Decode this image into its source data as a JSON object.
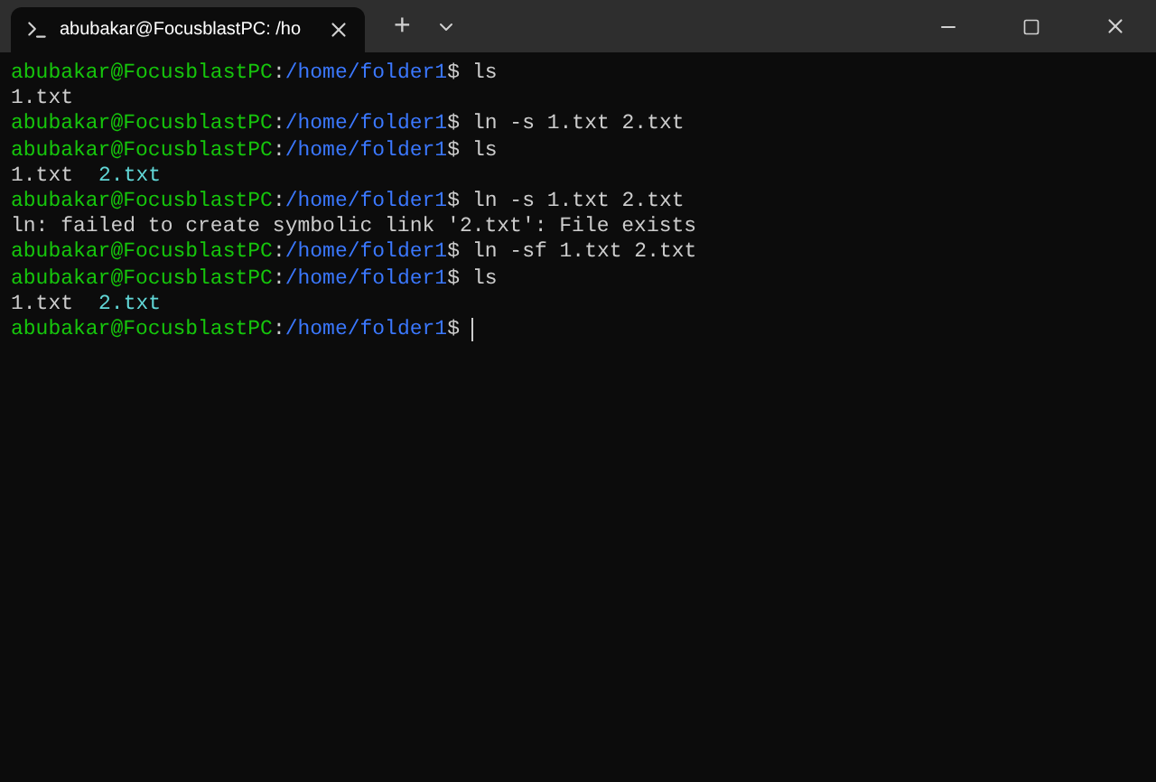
{
  "tab": {
    "title": "abubakar@FocusblastPC: /ho",
    "selected": true
  },
  "new_tab_button": "+",
  "lines": [
    {
      "kind": "prompt",
      "user": "abubakar@FocusblastPC",
      "separator": ":",
      "path": "/home/folder1",
      "symbol": "$",
      "command": "ls"
    },
    {
      "kind": "output",
      "parts": [
        {
          "text": "1.txt",
          "link": false
        }
      ]
    },
    {
      "kind": "prompt",
      "user": "abubakar@FocusblastPC",
      "separator": ":",
      "path": "/home/folder1",
      "symbol": "$",
      "command": "ln -s 1.txt 2.txt"
    },
    {
      "kind": "prompt",
      "user": "abubakar@FocusblastPC",
      "separator": ":",
      "path": "/home/folder1",
      "symbol": "$",
      "command": "ls"
    },
    {
      "kind": "output",
      "parts": [
        {
          "text": "1.txt",
          "link": false
        },
        {
          "text": "2.txt",
          "link": true
        }
      ]
    },
    {
      "kind": "prompt",
      "user": "abubakar@FocusblastPC",
      "separator": ":",
      "path": "/home/folder1",
      "symbol": "$",
      "command": "ln -s 1.txt 2.txt"
    },
    {
      "kind": "output",
      "parts": [
        {
          "text": "ln: failed to create symbolic link '2.txt': File exists",
          "link": false
        }
      ]
    },
    {
      "kind": "prompt",
      "user": "abubakar@FocusblastPC",
      "separator": ":",
      "path": "/home/folder1",
      "symbol": "$",
      "command": "ln -sf 1.txt 2.txt"
    },
    {
      "kind": "prompt",
      "user": "abubakar@FocusblastPC",
      "separator": ":",
      "path": "/home/folder1",
      "symbol": "$",
      "command": "ls"
    },
    {
      "kind": "output",
      "parts": [
        {
          "text": "1.txt",
          "link": false
        },
        {
          "text": "2.txt",
          "link": true
        }
      ]
    },
    {
      "kind": "prompt",
      "user": "abubakar@FocusblastPC",
      "separator": ":",
      "path": "/home/folder1",
      "symbol": "$",
      "cursor": true
    }
  ]
}
